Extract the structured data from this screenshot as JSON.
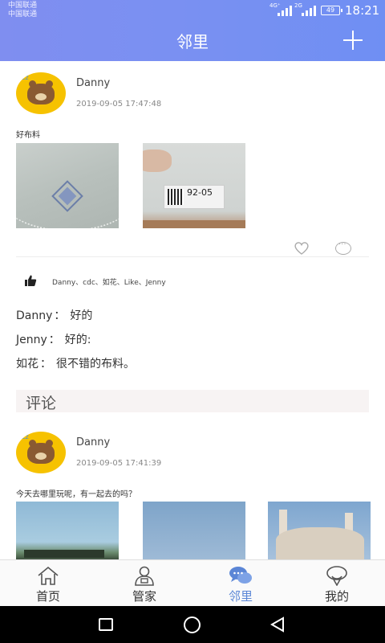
{
  "status_bar": {
    "carrier1": "中国联通",
    "carrier2": "中国联通",
    "net1": "4G⁺",
    "net2": "2G",
    "battery": "49",
    "time": "18:21"
  },
  "header": {
    "title": "邻里",
    "add_icon": "plus-icon"
  },
  "posts": [
    {
      "user": "Danny",
      "time": "2019-09-05 17:47:48",
      "text": "好布料",
      "photo2_label": "92-05",
      "likers": "Danny、cdc、如花、Like、Jenny",
      "comments": [
        {
          "name": "Danny",
          "sep": "：",
          "text": "好的"
        },
        {
          "name": "Jenny",
          "sep": "：",
          "text": "好的:"
        },
        {
          "name": "如花",
          "sep": "：",
          "text": "很不错的布料。"
        }
      ]
    },
    {
      "user": "Danny",
      "time": "2019-09-05 17:41:39",
      "text": "今天去哪里玩呢，有一起去的吗？"
    }
  ],
  "section_title": "评论",
  "nav": {
    "tabs": [
      {
        "label": "首页",
        "icon": "home-icon"
      },
      {
        "label": "管家",
        "icon": "butler-icon"
      },
      {
        "label": "邻里",
        "icon": "chat-bubbles-icon"
      },
      {
        "label": "我的",
        "icon": "user-icon"
      }
    ],
    "active_color": "#5b86d6"
  },
  "colors": {
    "header_start": "#7f8ef0",
    "header_end": "#6f8ff3",
    "avatar_bg": "#f6c200"
  }
}
